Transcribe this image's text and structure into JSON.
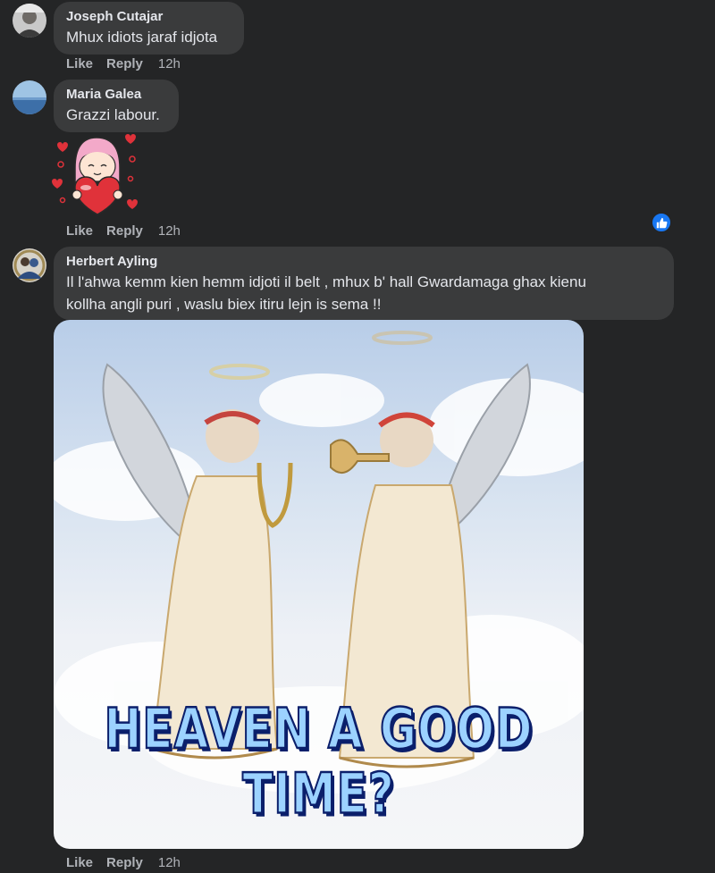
{
  "comments": [
    {
      "author": "Joseph Cutajar",
      "text": "Mhux idiots jaraf idjota",
      "like": "Like",
      "reply": "Reply",
      "time": "12h"
    },
    {
      "author": "Maria Galea",
      "text": "Grazzi labour.",
      "like": "Like",
      "reply": "Reply",
      "time": "12h",
      "sticker": "girl-hugging-heart-sticker"
    },
    {
      "author": "Herbert Ayling",
      "text_line1": "Il l'ahwa kemm kien hemm idjoti il belt , mhux b' hall Gwardamaga ghax kienu",
      "text_line2": "kollha angli puri , waslu biex itiru lejn is sema !!",
      "like": "Like",
      "reply": "Reply",
      "time": "12h",
      "gif_caption": "HEAVEN A GOOD TIME?"
    }
  ],
  "icons": {
    "like_reaction": "thumbs-up-icon"
  },
  "colors": {
    "background": "#242526",
    "bubble": "#3a3b3c",
    "text": "#e4e6eb",
    "secondary": "#b0b3b8",
    "like_blue": "#1877f2"
  }
}
